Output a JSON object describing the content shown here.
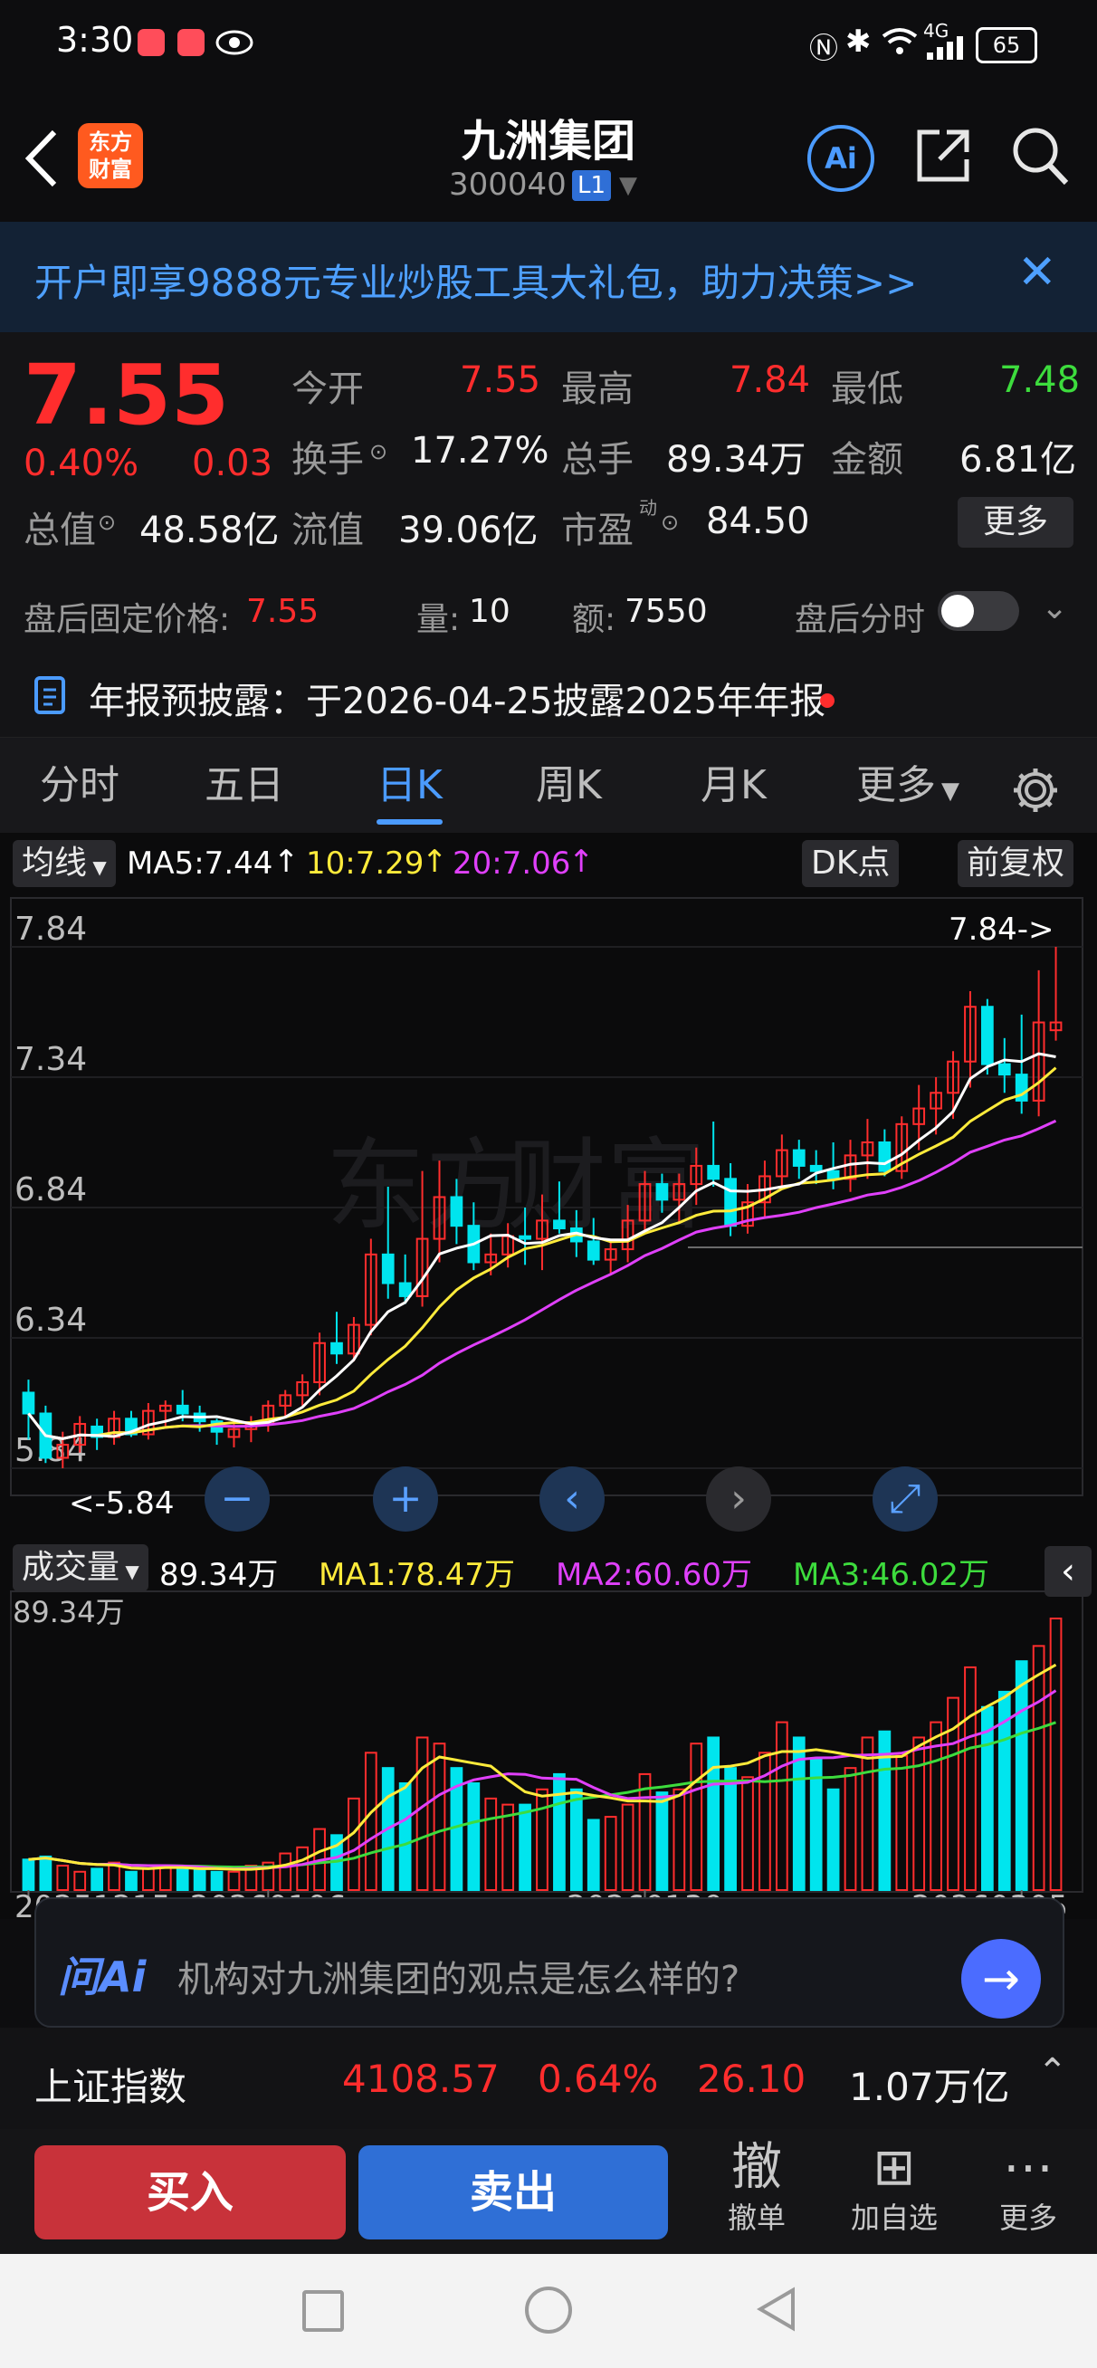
{
  "status_bar": {
    "time": "3:30",
    "battery": "65",
    "signal": "4G"
  },
  "header": {
    "logo_line1": "东方",
    "logo_line2": "财富",
    "stock_name": "九洲集团",
    "stock_code": "300040",
    "level_badge": "L1",
    "ai_label": "Ai"
  },
  "banner": {
    "text": "开户即享9888元专业炒股工具大礼包，助力决策>>"
  },
  "quote": {
    "price": "7.55",
    "change_pct": "0.40%",
    "change": "0.03",
    "open_label": "今开",
    "open": "7.55",
    "high_label": "最高",
    "high": "7.84",
    "low_label": "最低",
    "low": "7.48",
    "turnover_label": "换手",
    "turnover": "17.27%",
    "volume_label": "总手",
    "volume": "89.34万",
    "amount_label": "金额",
    "amount": "6.81亿",
    "mktcap_label": "总值",
    "mktcap": "48.58亿",
    "float_label": "流值",
    "float_cap": "39.06亿",
    "pe_label": "市盈",
    "pe_sup": "动",
    "pe": "84.50",
    "more": "更多"
  },
  "after_hours": {
    "label": "盘后固定价格:",
    "price": "7.55",
    "vol_label": "量:",
    "vol": "10",
    "amt_label": "额:",
    "amt": "7550",
    "toggle_label": "盘后分时"
  },
  "notice": {
    "text": "年报预披露：于2026-04-25披露2025年年报"
  },
  "tabs": [
    {
      "label": "分时"
    },
    {
      "label": "五日"
    },
    {
      "label": "日K"
    },
    {
      "label": "周K"
    },
    {
      "label": "月K"
    },
    {
      "label": "更多"
    }
  ],
  "chart_data": {
    "type": "candlestick",
    "ma_selector": "均线",
    "ma5_label": "MA5:7.44",
    "ma10_label": "10:7.29",
    "ma20_label": "20:7.06",
    "dk_label": "DK点",
    "adjust_label": "前复权",
    "y_ticks": [
      "7.84",
      "7.34",
      "6.84",
      "6.34",
      "5.84"
    ],
    "max_annotation": "7.84->",
    "min_annotation": "<-5.84",
    "x_ticks": [
      "20251215",
      "20260106",
      "20260130",
      "20260305"
    ],
    "candles_ohlc": [
      [
        6.13,
        6.18,
        5.95,
        6.05
      ],
      [
        6.05,
        6.08,
        5.86,
        5.88
      ],
      [
        5.88,
        5.98,
        5.84,
        5.93
      ],
      [
        5.93,
        6.04,
        5.9,
        6.01
      ],
      [
        6.0,
        6.03,
        5.91,
        5.96
      ],
      [
        5.96,
        6.06,
        5.93,
        6.03
      ],
      [
        6.03,
        6.06,
        5.96,
        5.97
      ],
      [
        5.97,
        6.09,
        5.95,
        6.06
      ],
      [
        6.06,
        6.1,
        6.0,
        6.08
      ],
      [
        6.08,
        6.14,
        6.02,
        6.05
      ],
      [
        6.05,
        6.08,
        5.98,
        6.02
      ],
      [
        6.02,
        6.03,
        5.93,
        5.98
      ],
      [
        5.96,
        6.01,
        5.92,
        5.99
      ],
      [
        5.99,
        6.04,
        5.94,
        6.01
      ],
      [
        6.01,
        6.1,
        5.98,
        6.08
      ],
      [
        6.08,
        6.14,
        6.04,
        6.12
      ],
      [
        6.12,
        6.2,
        6.08,
        6.17
      ],
      [
        6.17,
        6.36,
        6.12,
        6.32
      ],
      [
        6.32,
        6.44,
        6.24,
        6.28
      ],
      [
        6.28,
        6.42,
        6.25,
        6.39
      ],
      [
        6.39,
        6.72,
        6.35,
        6.66
      ],
      [
        6.66,
        6.92,
        6.49,
        6.55
      ],
      [
        6.55,
        6.66,
        6.47,
        6.5
      ],
      [
        6.5,
        6.98,
        6.46,
        6.72
      ],
      [
        6.72,
        7.02,
        6.63,
        6.88
      ],
      [
        6.88,
        6.95,
        6.7,
        6.77
      ],
      [
        6.77,
        6.86,
        6.6,
        6.63
      ],
      [
        6.63,
        6.74,
        6.58,
        6.66
      ],
      [
        6.66,
        6.78,
        6.61,
        6.73
      ],
      [
        6.73,
        6.84,
        6.62,
        6.72
      ],
      [
        6.72,
        6.89,
        6.6,
        6.79
      ],
      [
        6.79,
        6.94,
        6.74,
        6.76
      ],
      [
        6.76,
        6.83,
        6.65,
        6.71
      ],
      [
        6.71,
        6.8,
        6.62,
        6.64
      ],
      [
        6.64,
        6.72,
        6.58,
        6.68
      ],
      [
        6.68,
        6.85,
        6.63,
        6.79
      ],
      [
        6.79,
        6.98,
        6.74,
        6.93
      ],
      [
        6.93,
        6.97,
        6.82,
        6.87
      ],
      [
        6.87,
        6.97,
        6.78,
        6.93
      ],
      [
        6.93,
        7.07,
        6.85,
        7.0
      ],
      [
        7.0,
        7.17,
        6.92,
        6.95
      ],
      [
        6.95,
        7.01,
        6.73,
        6.77
      ],
      [
        6.77,
        6.93,
        6.74,
        6.86
      ],
      [
        6.86,
        7.02,
        6.8,
        6.96
      ],
      [
        6.96,
        7.12,
        6.91,
        7.06
      ],
      [
        7.06,
        7.1,
        6.95,
        7.0
      ],
      [
        7.0,
        7.06,
        6.93,
        6.98
      ],
      [
        6.98,
        7.09,
        6.91,
        6.95
      ],
      [
        6.95,
        7.1,
        6.9,
        7.04
      ],
      [
        7.04,
        7.18,
        6.95,
        7.09
      ],
      [
        7.09,
        7.14,
        6.96,
        6.98
      ],
      [
        6.98,
        7.19,
        6.95,
        7.16
      ],
      [
        7.16,
        7.31,
        7.06,
        7.22
      ],
      [
        7.22,
        7.34,
        7.12,
        7.28
      ],
      [
        7.28,
        7.44,
        7.18,
        7.4
      ],
      [
        7.4,
        7.67,
        7.3,
        7.61
      ],
      [
        7.61,
        7.64,
        7.35,
        7.39
      ],
      [
        7.39,
        7.49,
        7.28,
        7.35
      ],
      [
        7.35,
        7.58,
        7.2,
        7.25
      ],
      [
        7.25,
        7.75,
        7.19,
        7.55
      ],
      [
        7.52,
        7.84,
        7.48,
        7.55
      ]
    ],
    "volume_label": "成交量",
    "volume_value": "89.34万",
    "vol_ma1_label": "MA1:78.47万",
    "vol_ma2_label": "MA2:60.60万",
    "vol_ma3_label": "MA3:46.02万",
    "volume_y_tick": "89.34万",
    "volumes": [
      10,
      11,
      8,
      6,
      7,
      9,
      6,
      7,
      8,
      7,
      7,
      6,
      6,
      8,
      9,
      12,
      14,
      20,
      18,
      30,
      45,
      40,
      35,
      50,
      48,
      40,
      35,
      30,
      28,
      28,
      33,
      38,
      33,
      23,
      24,
      28,
      38,
      32,
      33,
      48,
      50,
      40,
      37,
      45,
      55,
      50,
      43,
      33,
      40,
      50,
      52,
      44,
      50,
      55,
      63,
      73,
      60,
      65,
      75,
      80,
      89
    ]
  },
  "zoom_controls": {
    "zoom_out": "−",
    "zoom_in": "+",
    "prev": "‹",
    "next": "›",
    "expand": "⤢"
  },
  "ai_bar": {
    "logo": "问Ai",
    "question": "机构对九洲集团的观点是怎么样的?"
  },
  "index": {
    "name": "上证指数",
    "value": "4108.57",
    "change_pct": "0.64%",
    "change": "26.10",
    "turnover": "1.07万亿"
  },
  "bottom": {
    "buy": "买入",
    "sell": "卖出",
    "cancel_icon": "撤",
    "cancel": "撤单",
    "add": "加自选",
    "more": "更多"
  },
  "colors": {
    "up": "#ff2d2d",
    "down": "#00e5ee",
    "ma5": "#ffffff",
    "ma10": "#ffeb3b",
    "ma20": "#e040fb",
    "accent": "#4b9bff",
    "buy": "#c8323a",
    "sell": "#2f6fd6"
  }
}
